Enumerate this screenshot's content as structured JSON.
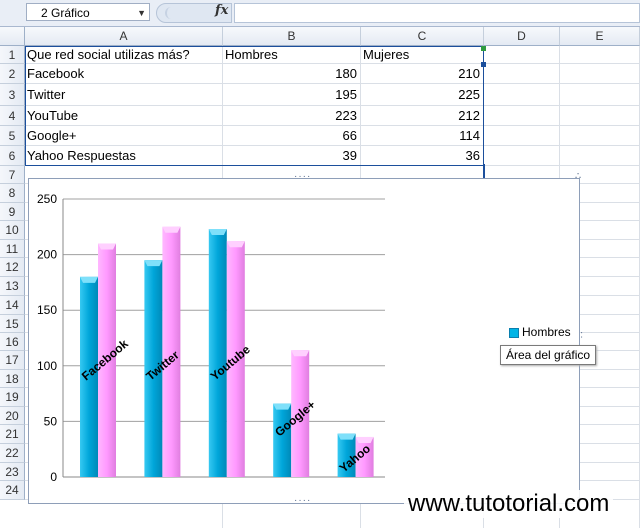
{
  "formula_bar": {
    "name_box": "2 Gráfico",
    "fx_symbol": "fx",
    "formula": ""
  },
  "columns": [
    "A",
    "B",
    "C",
    "D",
    "E"
  ],
  "rows": [
    "1",
    "2",
    "3",
    "4",
    "5",
    "6",
    "7",
    "8",
    "9",
    "10",
    "11",
    "12",
    "13",
    "14",
    "15",
    "16",
    "17",
    "18",
    "19",
    "20",
    "21",
    "22",
    "23",
    "24"
  ],
  "sheet": {
    "header": [
      "Que red social utilizas más?",
      "Hombres",
      "Mujeres"
    ],
    "data": [
      {
        "label": "Facebook",
        "hombres": "180",
        "mujeres": "210"
      },
      {
        "label": "Twitter",
        "hombres": "195",
        "mujeres": "225"
      },
      {
        "label": "YouTube",
        "hombres": "223",
        "mujeres": "212"
      },
      {
        "label": "Google+",
        "hombres": "66",
        "mujeres": "114"
      },
      {
        "label": "Yahoo Respuestas",
        "hombres": "39",
        "mujeres": "36"
      }
    ]
  },
  "chart_data": {
    "type": "bar",
    "categories": [
      "Facebook",
      "Twitter",
      "Youtube",
      "Google+",
      "Yahoo"
    ],
    "series": [
      {
        "name": "Hombres",
        "values": [
          180,
          195,
          223,
          66,
          39
        ],
        "color": "#00b4e6"
      },
      {
        "values": [
          210,
          225,
          212,
          114,
          36
        ],
        "color": "#ff99ff"
      }
    ],
    "yticks": [
      "0",
      "50",
      "100",
      "150",
      "200",
      "250"
    ],
    "ylim": [
      0,
      250
    ],
    "grid": true,
    "legend_position": "right"
  },
  "tooltip": "Área del gráfico",
  "watermark": "www.tutotorial.com",
  "colors": {
    "hombres": "#00b4e6",
    "mujeres": "#ff99ff",
    "header_bg": "#e4eaf3"
  }
}
